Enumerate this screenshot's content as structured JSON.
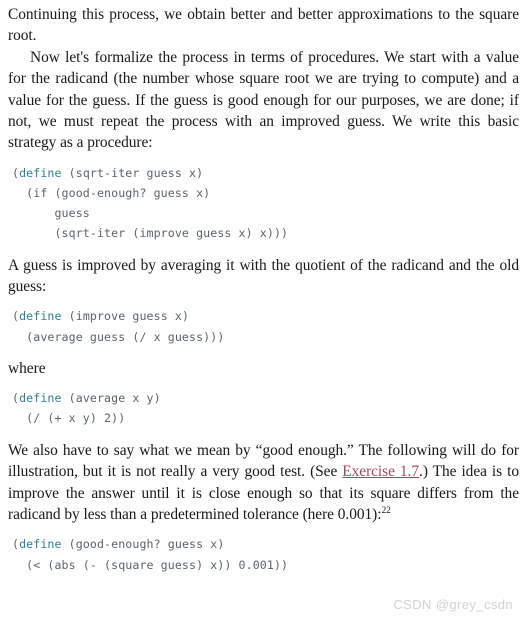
{
  "document": {
    "paragraphs": {
      "p1": "Continuing this process, we obtain better and better approximations to the square root.",
      "p2": "Now let's formalize the process in terms of procedures. We start with a value for the radicand (the number whose square root we are trying to compute) and a value for the guess. If the guess is good enough for our purposes, we are done; if not, we must repeat the process with an improved guess. We write this basic strategy as a procedure:",
      "p3": "A guess is improved by averaging it with the quotient of the radicand and the old guess:",
      "p4_where": "where",
      "p5_part1": "We also have to say what we mean by “good enough.” The following will do for illustration, but it is not really a very good test. (See ",
      "p5_link": "Exercise 1.7",
      "p5_part2": ".) The idea is to improve the answer until it is close enough so that its square differs from the radicand by less than a predetermined tolerance (here 0.001):",
      "p5_footnote_marker": "22"
    },
    "code_blocks": {
      "sqrt_iter": {
        "keyword": "define",
        "before_keyword": "(",
        "rest": " (sqrt-iter guess x)\n  (if (good-enough? guess x)\n      guess\n      (sqrt-iter (improve guess x) x)))"
      },
      "improve": {
        "keyword": "define",
        "before_keyword": "(",
        "rest": " (improve guess x)\n  (average guess (/ x guess)))"
      },
      "average": {
        "keyword": "define",
        "before_keyword": "(",
        "rest": " (average x y)\n  (/ (+ x y) 2))"
      },
      "good_enough": {
        "keyword": "define",
        "before_keyword": "(",
        "rest": " (good-enough? guess x)\n  (< (abs (- (square guess) x)) 0.001))"
      }
    },
    "watermark": "CSDN @grey_csdn",
    "colors": {
      "body_text": "#16181a",
      "code_text": "#5c6469",
      "code_keyword": "#2f7f8f",
      "link": "#a8445a",
      "watermark": "#d2d2d2",
      "page_background": "#fefefe"
    }
  }
}
